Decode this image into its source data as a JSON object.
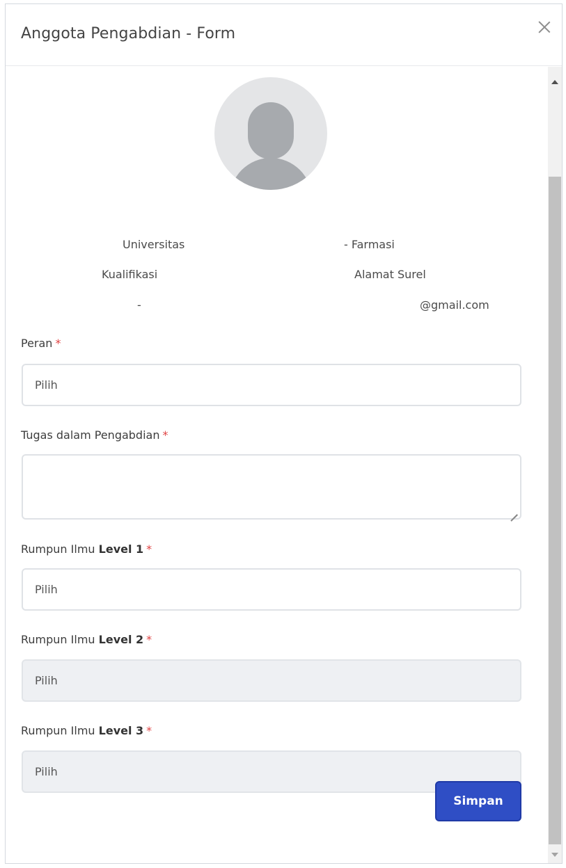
{
  "header": {
    "title": "Anggota Pengabdian - Form"
  },
  "profile": {
    "universitas_label": "Universitas",
    "prodi_value": "- Farmasi",
    "kualifikasi_label": "Kualifikasi",
    "alamat_surel_label": "Alamat Surel",
    "kualifikasi_value": "-",
    "email_value": "@gmail.com"
  },
  "form": {
    "peran": {
      "label": "Peran",
      "required": "*",
      "placeholder": "Pilih"
    },
    "tugas": {
      "label": "Tugas dalam Pengabdian",
      "required": "*",
      "value": ""
    },
    "rumpun1": {
      "label_prefix": "Rumpun Ilmu",
      "label_strong": "Level 1",
      "required": "*",
      "placeholder": "Pilih"
    },
    "rumpun2": {
      "label_prefix": "Rumpun Ilmu",
      "label_strong": "Level 2",
      "required": "*",
      "placeholder": "Pilih"
    },
    "rumpun3": {
      "label_prefix": "Rumpun Ilmu",
      "label_strong": "Level 3",
      "required": "*",
      "placeholder": "Pilih"
    },
    "submit_label": "Simpan"
  },
  "colors": {
    "primary": "#2f4ec5",
    "required": "#e04343",
    "disabled_bg": "#eef0f3"
  }
}
